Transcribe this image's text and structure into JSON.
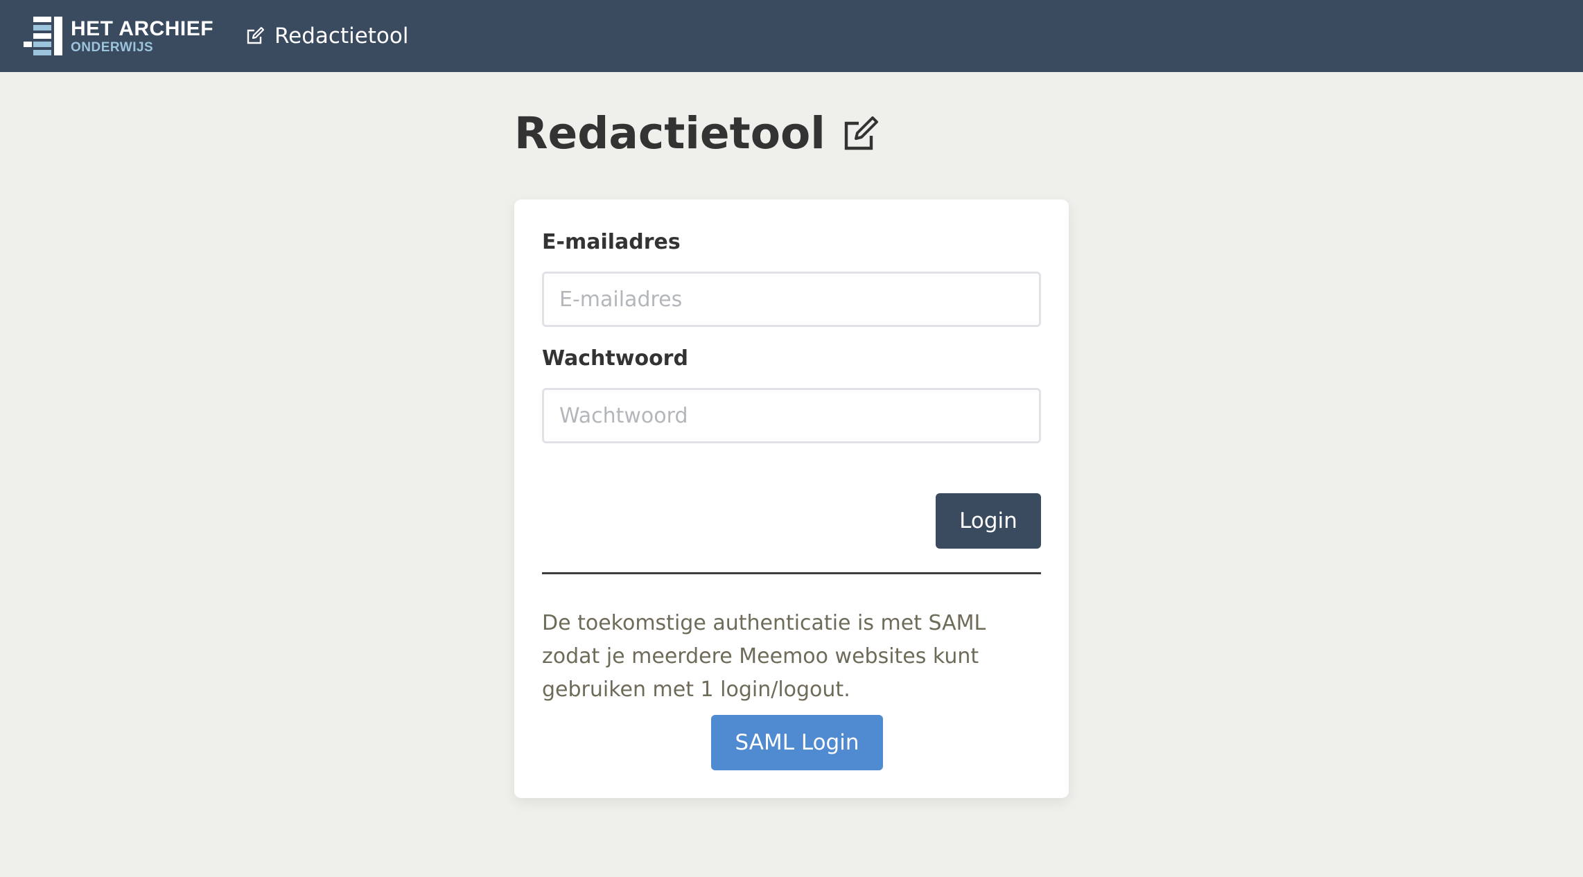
{
  "header": {
    "logo": {
      "title": "HET ARCHIEF",
      "subtitle": "ONDERWIJS"
    },
    "nav_label": "Redactietool",
    "nav_icon": "edit-icon",
    "background_color": "#3a4a5f"
  },
  "page": {
    "title": "Redactietool",
    "title_icon": "edit-icon"
  },
  "form": {
    "email_label": "E-mailadres",
    "email_placeholder": "E-mailadres",
    "email_value": "",
    "password_label": "Wachtwoord",
    "password_placeholder": "Wachtwoord",
    "password_value": "",
    "login_button": "Login",
    "login_button_color": "#3a4a5f"
  },
  "saml": {
    "info_text": "De toekomstige authenticatie is met SAML zodat je meerdere Meemoo websites kunt gebruiken met 1 login/logout.",
    "button": "SAML Login",
    "button_color": "#508ad0"
  }
}
